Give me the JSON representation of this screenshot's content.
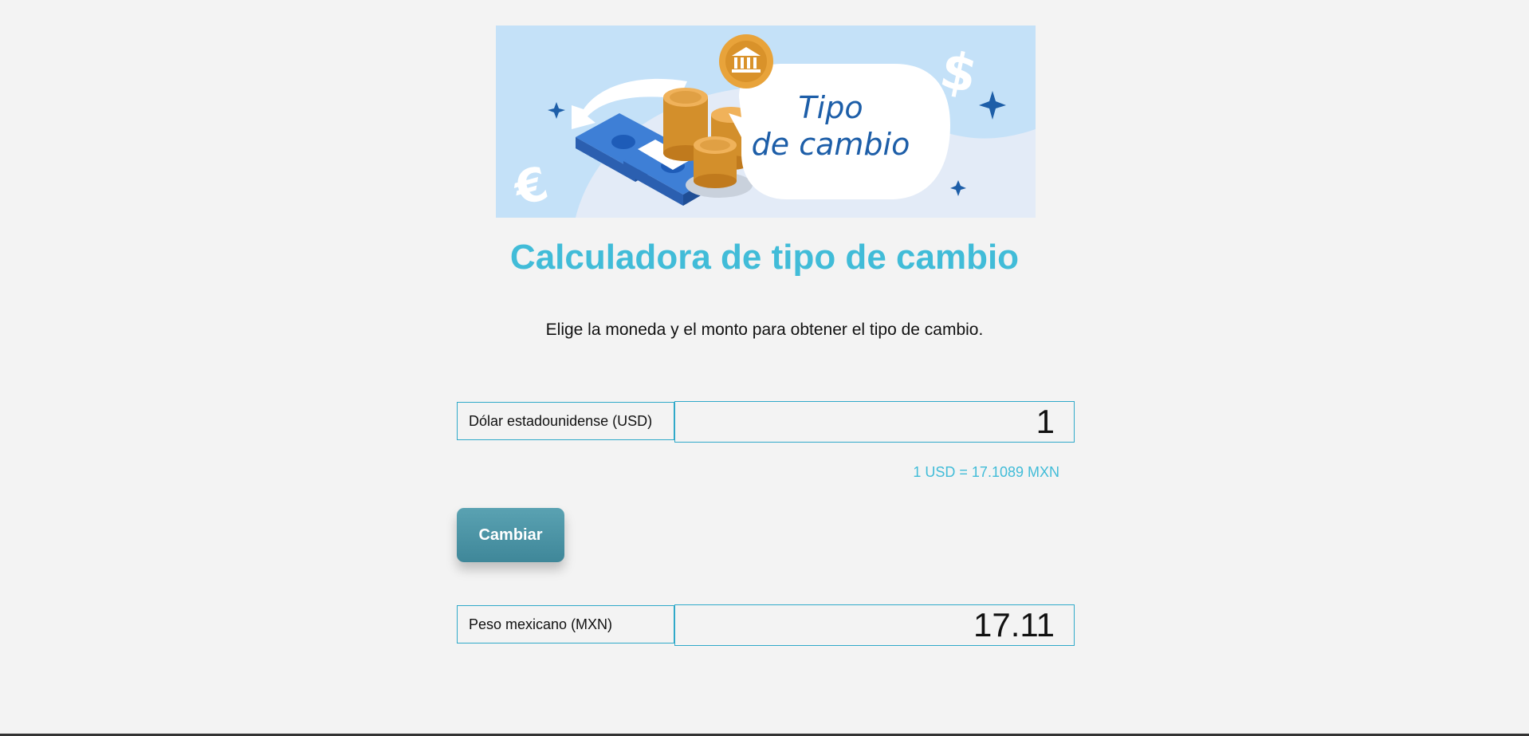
{
  "banner": {
    "line1": "Tipo",
    "line2": "de cambio",
    "icons": [
      "bank-icon",
      "dollar-icon",
      "euro-icon",
      "sparkle-icon",
      "coins-icon",
      "banknotes-icon",
      "exchange-arrow-icon"
    ]
  },
  "header": {
    "title": "Calculadora de tipo de cambio",
    "subtitle": "Elige la moneda y el monto para obtener el tipo de cambio."
  },
  "from": {
    "currency": "Dólar estadounidense (USD)",
    "amount": "1"
  },
  "rate_text": "1 USD = 17.1089 MXN",
  "swap_button": "Cambiar",
  "to": {
    "currency": "Peso mexicano (MXN)",
    "amount": "17.11"
  },
  "colors": {
    "accent": "#41bcd8",
    "border": "#2fa9c9",
    "button": "#4a95a7",
    "background": "#f3f3f3"
  }
}
